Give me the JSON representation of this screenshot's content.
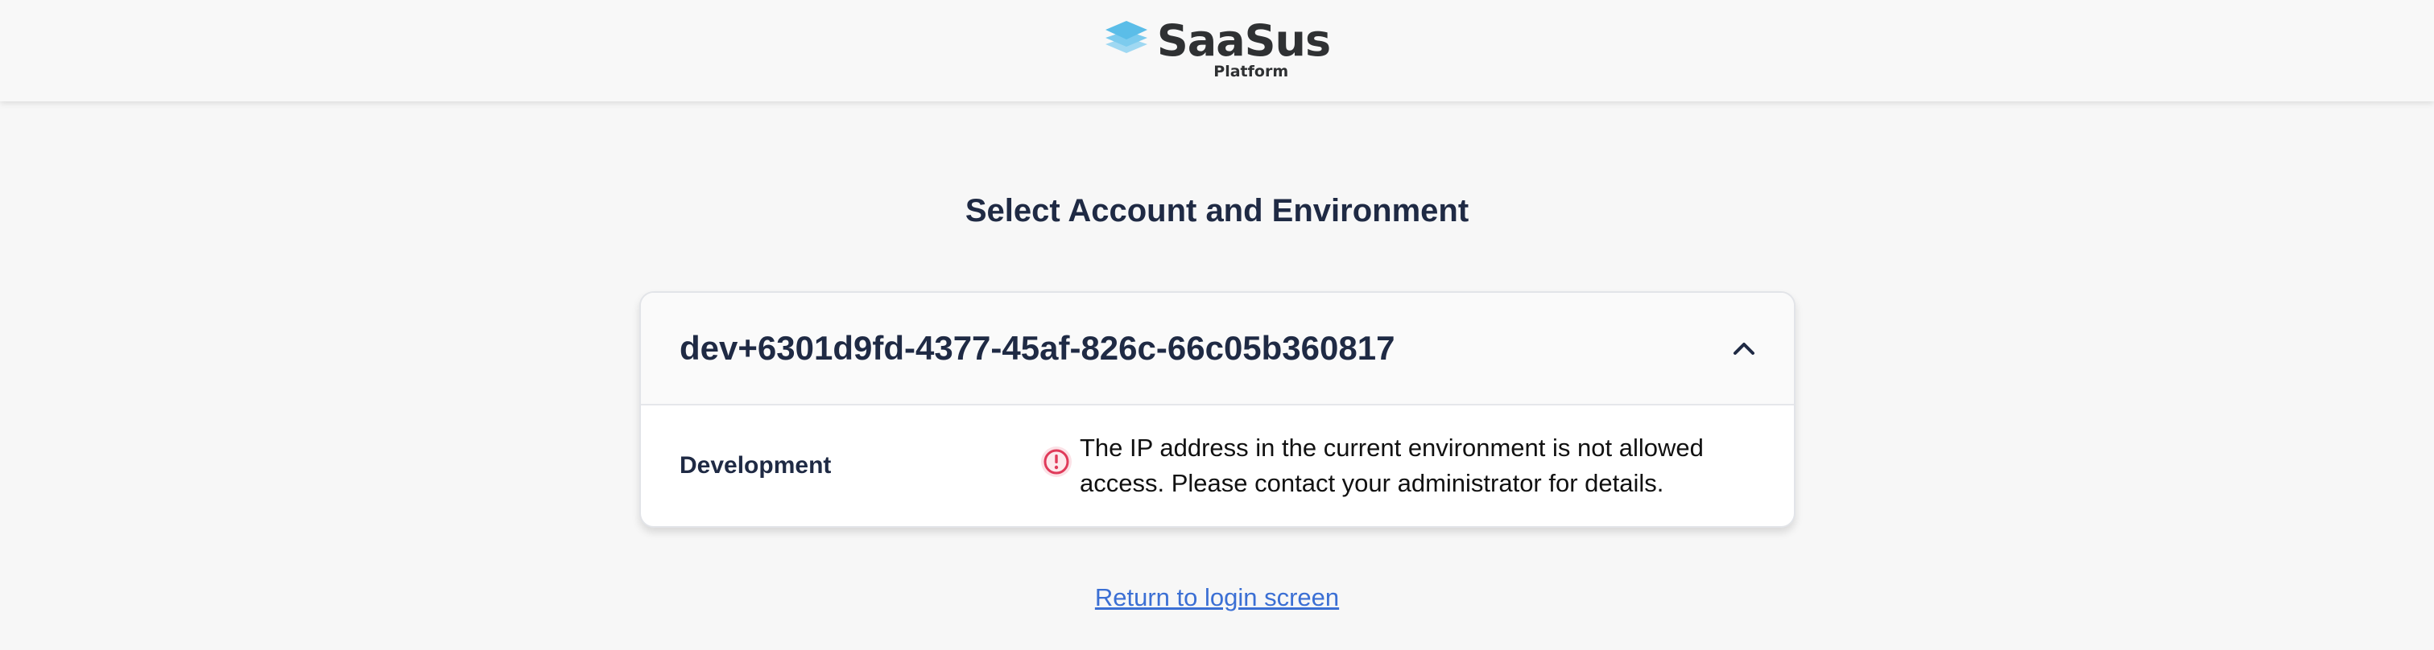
{
  "header": {
    "logo_title": "SaaSus",
    "logo_subtitle": "Platform",
    "logo_icon": "layered-diamond-logo-icon"
  },
  "page": {
    "title": "Select Account and Environment"
  },
  "account": {
    "id": "dev+6301d9fd-4377-45af-826c-66c05b360817",
    "expanded": true,
    "toggle_icon": "chevron-up-icon",
    "environments": [
      {
        "name": "Development",
        "status_icon": "exclamation-circle-icon",
        "message": "The IP address in the current environment is not allowed access. Please contact your administrator for details."
      }
    ]
  },
  "footer": {
    "return_link": "Return to login screen"
  },
  "colors": {
    "background": "#f7f7f7",
    "heading": "#1f2a44",
    "link": "#3b6fd4",
    "warning": "#e03a5a",
    "logo_accent": "#5bbde8"
  }
}
